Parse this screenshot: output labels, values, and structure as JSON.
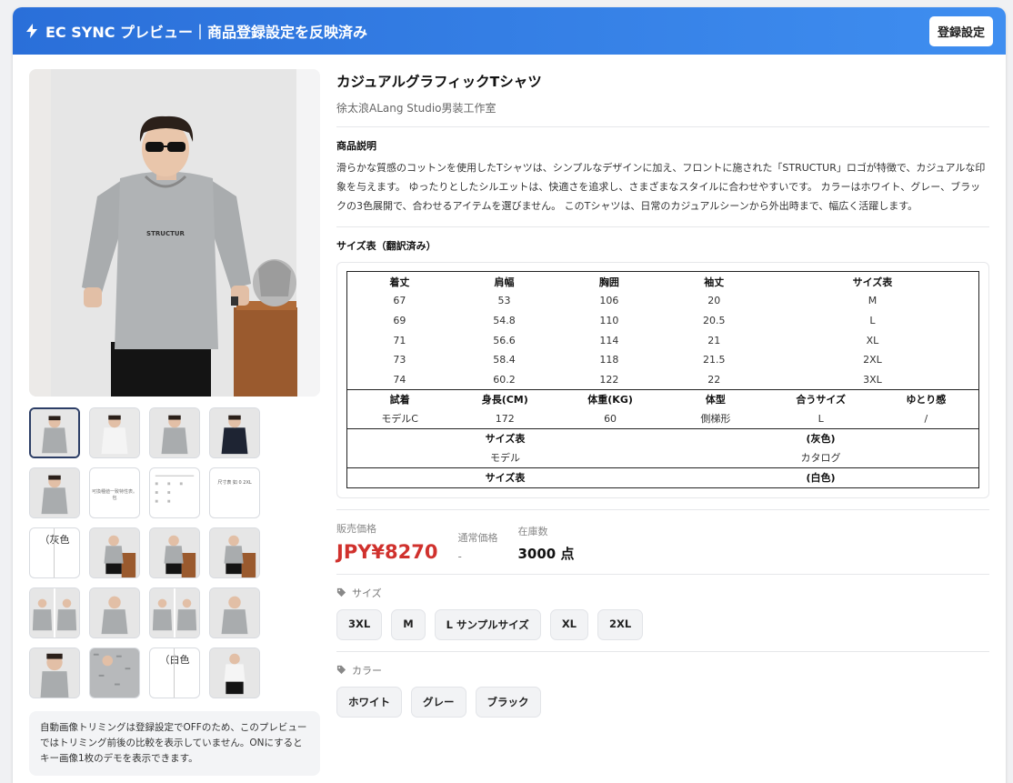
{
  "header": {
    "title": "EC SYNC プレビュー｜商品登録設定を反映済み",
    "settings_label": "登録設定",
    "bolt_icon": "bolt-icon"
  },
  "product": {
    "title": "カジュアルグラフィックTシャツ",
    "shop": "徐太浪ALang Studio男装工作室",
    "description_label": "商品説明",
    "description": "滑らかな質感のコットンを使用したTシャツは、シンプルなデザインに加え、フロントに施された「STRUCTUR」ロゴが特徴で、カジュアルな印象を与えます。 ゆったりとしたシルエットは、快適さを追求し、さまざまなスタイルに合わせやすいです。 カラーはホワイト、グレー、ブラックの3色展開で、合わせるアイテムを選びません。 このTシャツは、日常のカジュアルシーンから外出時まで、幅広く活躍します。",
    "shirt_logo": "STRUCTUR"
  },
  "size_table": {
    "label": "サイズ表（翻訳済み）",
    "headers": [
      "着丈",
      "肩幅",
      "胸囲",
      "袖丈",
      "サイズ表"
    ],
    "rows": [
      [
        "67",
        "53",
        "106",
        "20",
        "M"
      ],
      [
        "69",
        "54.8",
        "110",
        "20.5",
        "L"
      ],
      [
        "71",
        "56.6",
        "114",
        "21",
        "XL"
      ],
      [
        "73",
        "58.4",
        "118",
        "21.5",
        "2XL"
      ],
      [
        "74",
        "60.2",
        "122",
        "22",
        "3XL"
      ]
    ],
    "model_headers": [
      "試着",
      "身長(CM)",
      "体重(KG)",
      "体型",
      "合うサイズ",
      "ゆとり感"
    ],
    "model_row": [
      "モデルC",
      "172",
      "60",
      "側梯形",
      "L",
      "/"
    ],
    "block3_headers": [
      "サイズ表",
      "(灰色)"
    ],
    "block3_row": [
      "モデル",
      "カタログ"
    ],
    "block4_headers": [
      "サイズ表",
      "(白色)"
    ]
  },
  "pricing": {
    "sale_label": "販売価格",
    "sale_price": "JPY¥8270",
    "regular_label": "通常価格",
    "regular_price": "-",
    "stock_label": "在庫数",
    "stock_value": "3000 点"
  },
  "options": {
    "size_label": "サイズ",
    "sizes": [
      "3XL",
      "M",
      "L サンプルサイズ",
      "XL",
      "2XL"
    ],
    "color_label": "カラー",
    "colors": [
      "ホワイト",
      "グレー",
      "ブラック"
    ]
  },
  "thumbnails": {
    "tiny_text_1": "可換種値一致特性表。包",
    "tiny_text_2": "尺寸表 如 0 2XL",
    "gray_label": "（灰色",
    "white_label": "（白色"
  },
  "note": "自動画像トリミングは登録設定でOFFのため、このプレビューではトリミング前後の比較を表示していません。ONにするとキー画像1枚のデモを表示できます。",
  "colors": {
    "header_start": "#2a6fd9",
    "header_end": "#3f8ef0",
    "price_red": "#d0312d",
    "shirt_gray": "#a9acae"
  }
}
